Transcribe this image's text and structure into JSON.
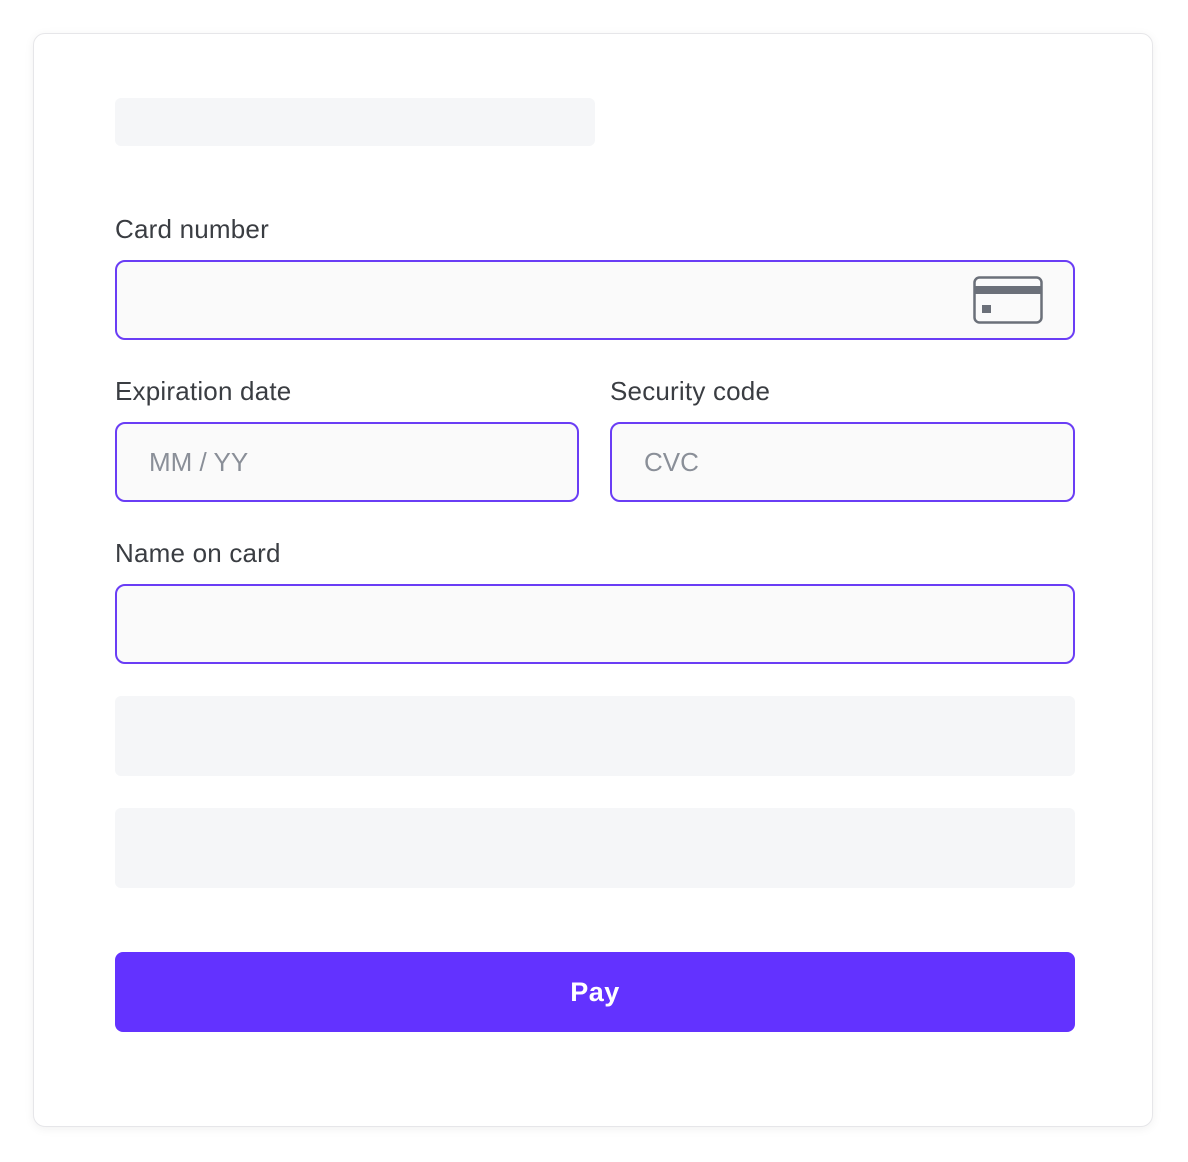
{
  "form": {
    "card_number": {
      "label": "Card number",
      "value": "",
      "placeholder": "",
      "icon": "credit-card-icon"
    },
    "expiration": {
      "label": "Expiration date",
      "value": "",
      "placeholder": "MM / YY"
    },
    "security_code": {
      "label": "Security code",
      "value": "",
      "placeholder": "CVC"
    },
    "name_on_card": {
      "label": "Name on card",
      "value": "",
      "placeholder": ""
    },
    "pay_label": "Pay"
  },
  "colors": {
    "accent": "#6332ff",
    "field_border": "#6a3df5",
    "skeleton": "#f5f6f8",
    "label_text": "#3a3d42",
    "placeholder_text": "#8a8f98"
  }
}
